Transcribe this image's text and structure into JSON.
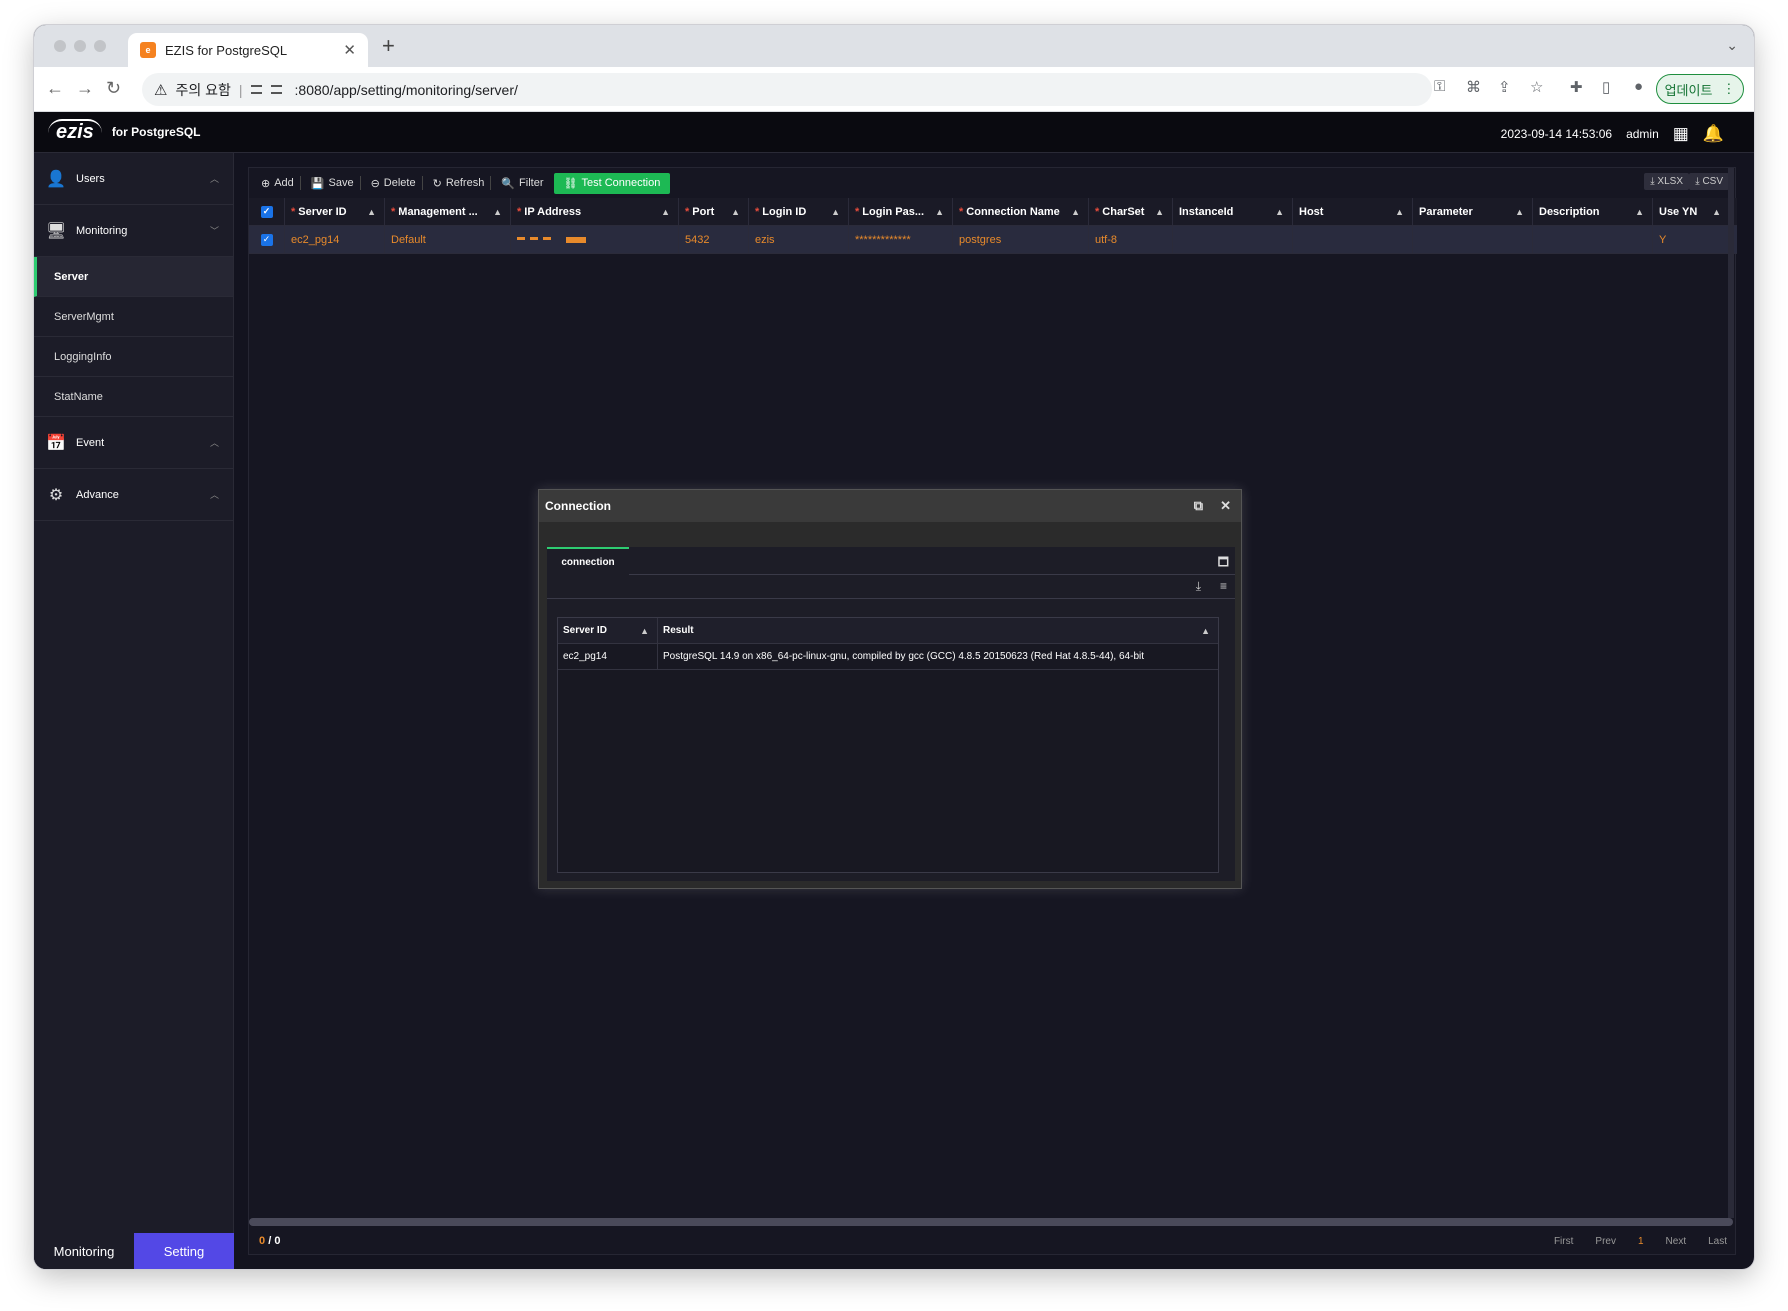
{
  "browser": {
    "tab_title": "EZIS for PostgreSQL",
    "tab_favicon": "ezis",
    "address_warning": "주의 요함",
    "url": ":8080/app/setting/monitoring/server/",
    "update_label": "업데이트"
  },
  "header": {
    "logo": "ezis",
    "product": "for PostgreSQL",
    "datetime": "2023-09-14 14:53:06",
    "user": "admin"
  },
  "sidebar": {
    "groups": [
      {
        "label": "Users",
        "icon": "user-icon"
      },
      {
        "label": "Monitoring",
        "icon": "monitor-icon"
      },
      {
        "label": "Event",
        "icon": "event-icon"
      },
      {
        "label": "Advance",
        "icon": "advance-icon"
      }
    ],
    "items": [
      {
        "label": "Server",
        "active": true
      },
      {
        "label": "ServerMgmt"
      },
      {
        "label": "LoggingInfo"
      },
      {
        "label": "StatName"
      }
    ],
    "footer": {
      "monitoring": "Monitoring",
      "setting": "Setting"
    }
  },
  "toolbar": {
    "add": "Add",
    "save": "Save",
    "delete": "Delete",
    "refresh": "Refresh",
    "filter": "Filter",
    "test_connection": "Test Connection",
    "xlsx": "XLSX",
    "csv": "CSV"
  },
  "grid": {
    "columns": [
      {
        "label": "Server ID",
        "required": true
      },
      {
        "label": "Management ...",
        "required": true
      },
      {
        "label": "IP Address",
        "required": true
      },
      {
        "label": "Port",
        "required": true
      },
      {
        "label": "Login ID",
        "required": true
      },
      {
        "label": "Login Pas...",
        "required": true
      },
      {
        "label": "Connection Name",
        "required": true
      },
      {
        "label": "CharSet",
        "required": true
      },
      {
        "label": "InstanceId",
        "required": false
      },
      {
        "label": "Host",
        "required": false
      },
      {
        "label": "Parameter",
        "required": false
      },
      {
        "label": "Description",
        "required": false
      },
      {
        "label": "Use YN",
        "required": false
      }
    ],
    "row": {
      "server_id": "ec2_pg14",
      "management": "Default",
      "port": "5432",
      "login_id": "ezis",
      "login_password": "*************",
      "connection_name": "postgres",
      "charset": "utf-8",
      "instance_id": "",
      "host": "",
      "parameter": "",
      "description": "",
      "use_yn": "Y"
    }
  },
  "pager": {
    "count": "0",
    "total": "0",
    "first": "First",
    "prev": "Prev",
    "page": "1",
    "next": "Next",
    "last": "Last"
  },
  "modal": {
    "title": "Connection",
    "tab": "connection",
    "columns": [
      "Server ID",
      "Result"
    ],
    "row": {
      "server_id": "ec2_pg14",
      "result": "PostgreSQL 14.9 on x86_64-pc-linux-gnu, compiled by gcc (GCC) 4.8.5 20150623 (Red Hat 4.8.5-44), 64-bit"
    }
  },
  "colors": {
    "accent_green": "#2ecc71",
    "setting_blue": "#5348e6",
    "data_orange": "#e88a2b"
  }
}
